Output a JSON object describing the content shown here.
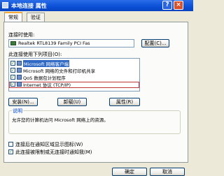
{
  "window": {
    "title": "本地连接 属性",
    "help_label": "?",
    "close_label": "×"
  },
  "tabs": [
    {
      "label": "常规"
    },
    {
      "label": "验证"
    }
  ],
  "connect_using": {
    "label": "连接时使用:",
    "adapter": "Realtek RTL8139 Family PCI Fas",
    "configure_label": "配置(C)..."
  },
  "items": {
    "label": "此连接使用下列项目(O):",
    "rows": [
      {
        "label": "Microsoft 网络客户端",
        "checked": "✓"
      },
      {
        "label": "Microsoft 网络的文件和打印机共享",
        "checked": "✓"
      },
      {
        "label": "QoS 数据包计划程序",
        "checked": "✓"
      },
      {
        "label": "Internet 协议 (TCP/IP)",
        "checked": "✓"
      }
    ]
  },
  "actions": {
    "install": "安装(N)...",
    "uninstall": "卸载(U)",
    "properties": "属性(R)"
  },
  "description": {
    "legend": "说明",
    "text": "允许您的计算机访问 Microsoft 网络上的资源。"
  },
  "options": {
    "show_icon": "连接后在通知区域显示图标(W)",
    "notify": "此连接被限制或无连接时通知我(M)"
  },
  "footer": {
    "ok": "确定",
    "cancel": "取消"
  }
}
